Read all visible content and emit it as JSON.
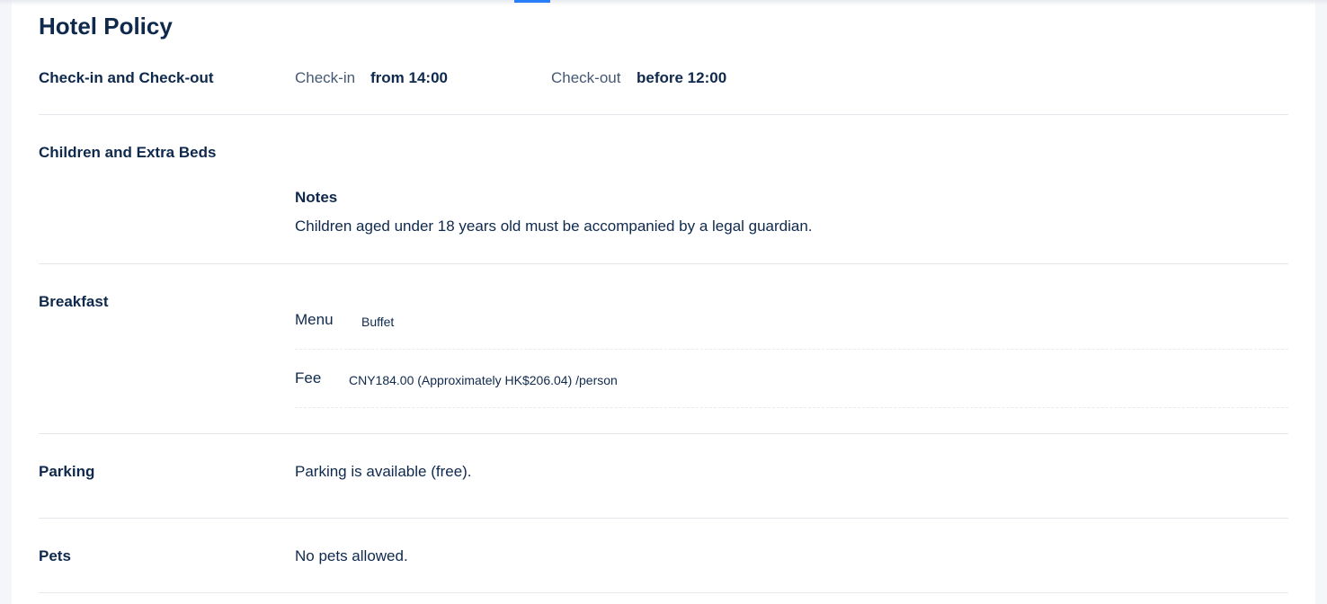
{
  "title": "Hotel Policy",
  "checkin": {
    "label": "Check-in and Check-out",
    "checkin_label": "Check-in",
    "checkin_value": "from 14:00",
    "checkout_label": "Check-out",
    "checkout_value": "before 12:00"
  },
  "children": {
    "label": "Children and Extra Beds",
    "notes_title": "Notes",
    "notes_text": "Children aged under 18 years old must be accompanied by a legal guardian."
  },
  "breakfast": {
    "label": "Breakfast",
    "menu_label": "Menu",
    "menu_value": "Buffet",
    "fee_label": "Fee",
    "fee_value": "CNY184.00 (Approximately HK$206.04) /person"
  },
  "parking": {
    "label": "Parking",
    "text": "Parking is available (free)."
  },
  "pets": {
    "label": "Pets",
    "text": "No pets allowed."
  },
  "colors": {
    "primary_text": "#0f294d",
    "accent": "#287dfa",
    "divider": "#e4e7ec",
    "page_bg": "#f4f6fa"
  }
}
